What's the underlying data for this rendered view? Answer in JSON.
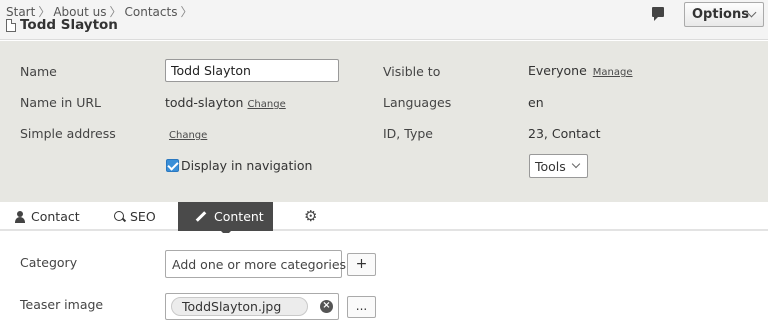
{
  "breadcrumb": {
    "items": [
      "Start",
      "About us",
      "Contacts"
    ],
    "separator": "〉"
  },
  "page": {
    "title": "Todd Slayton",
    "icon": "document-icon"
  },
  "header": {
    "options_label": "Options",
    "comment_icon": "comment-icon"
  },
  "info": {
    "name_label": "Name",
    "name_value": "Todd Slayton",
    "name_in_url_label": "Name in URL",
    "name_in_url_value": "todd-slayton",
    "name_in_url_change": "Change",
    "simple_address_label": "Simple address",
    "simple_address_change": "Change",
    "display_in_nav_label": "Display in navigation",
    "display_in_nav_checked": true,
    "visible_to_label": "Visible to",
    "visible_to_value": "Everyone",
    "visible_to_manage": "Manage",
    "languages_label": "Languages",
    "languages_value": "en",
    "id_type_label": "ID, Type",
    "id_type_value": "23, Contact",
    "tools_label": "Tools"
  },
  "tabs": [
    {
      "label": "Contact",
      "icon": "person-icon",
      "active": false
    },
    {
      "label": "SEO",
      "icon": "search-icon",
      "active": false
    },
    {
      "label": "Content",
      "icon": "pencil-icon",
      "active": true
    },
    {
      "label": "",
      "icon": "gear-icon",
      "active": false
    }
  ],
  "content": {
    "category_label": "Category",
    "category_placeholder": "Add one or more categories",
    "add_button": "+",
    "teaser_image_label": "Teaser image",
    "teaser_image_file": "ToddSlayton.jpg",
    "browse_button": "..."
  },
  "colors": {
    "panel_bg": "#e7e7e2",
    "active_tab_bg": "#4a4a4a",
    "checkbox_blue": "#3a8fd8"
  }
}
